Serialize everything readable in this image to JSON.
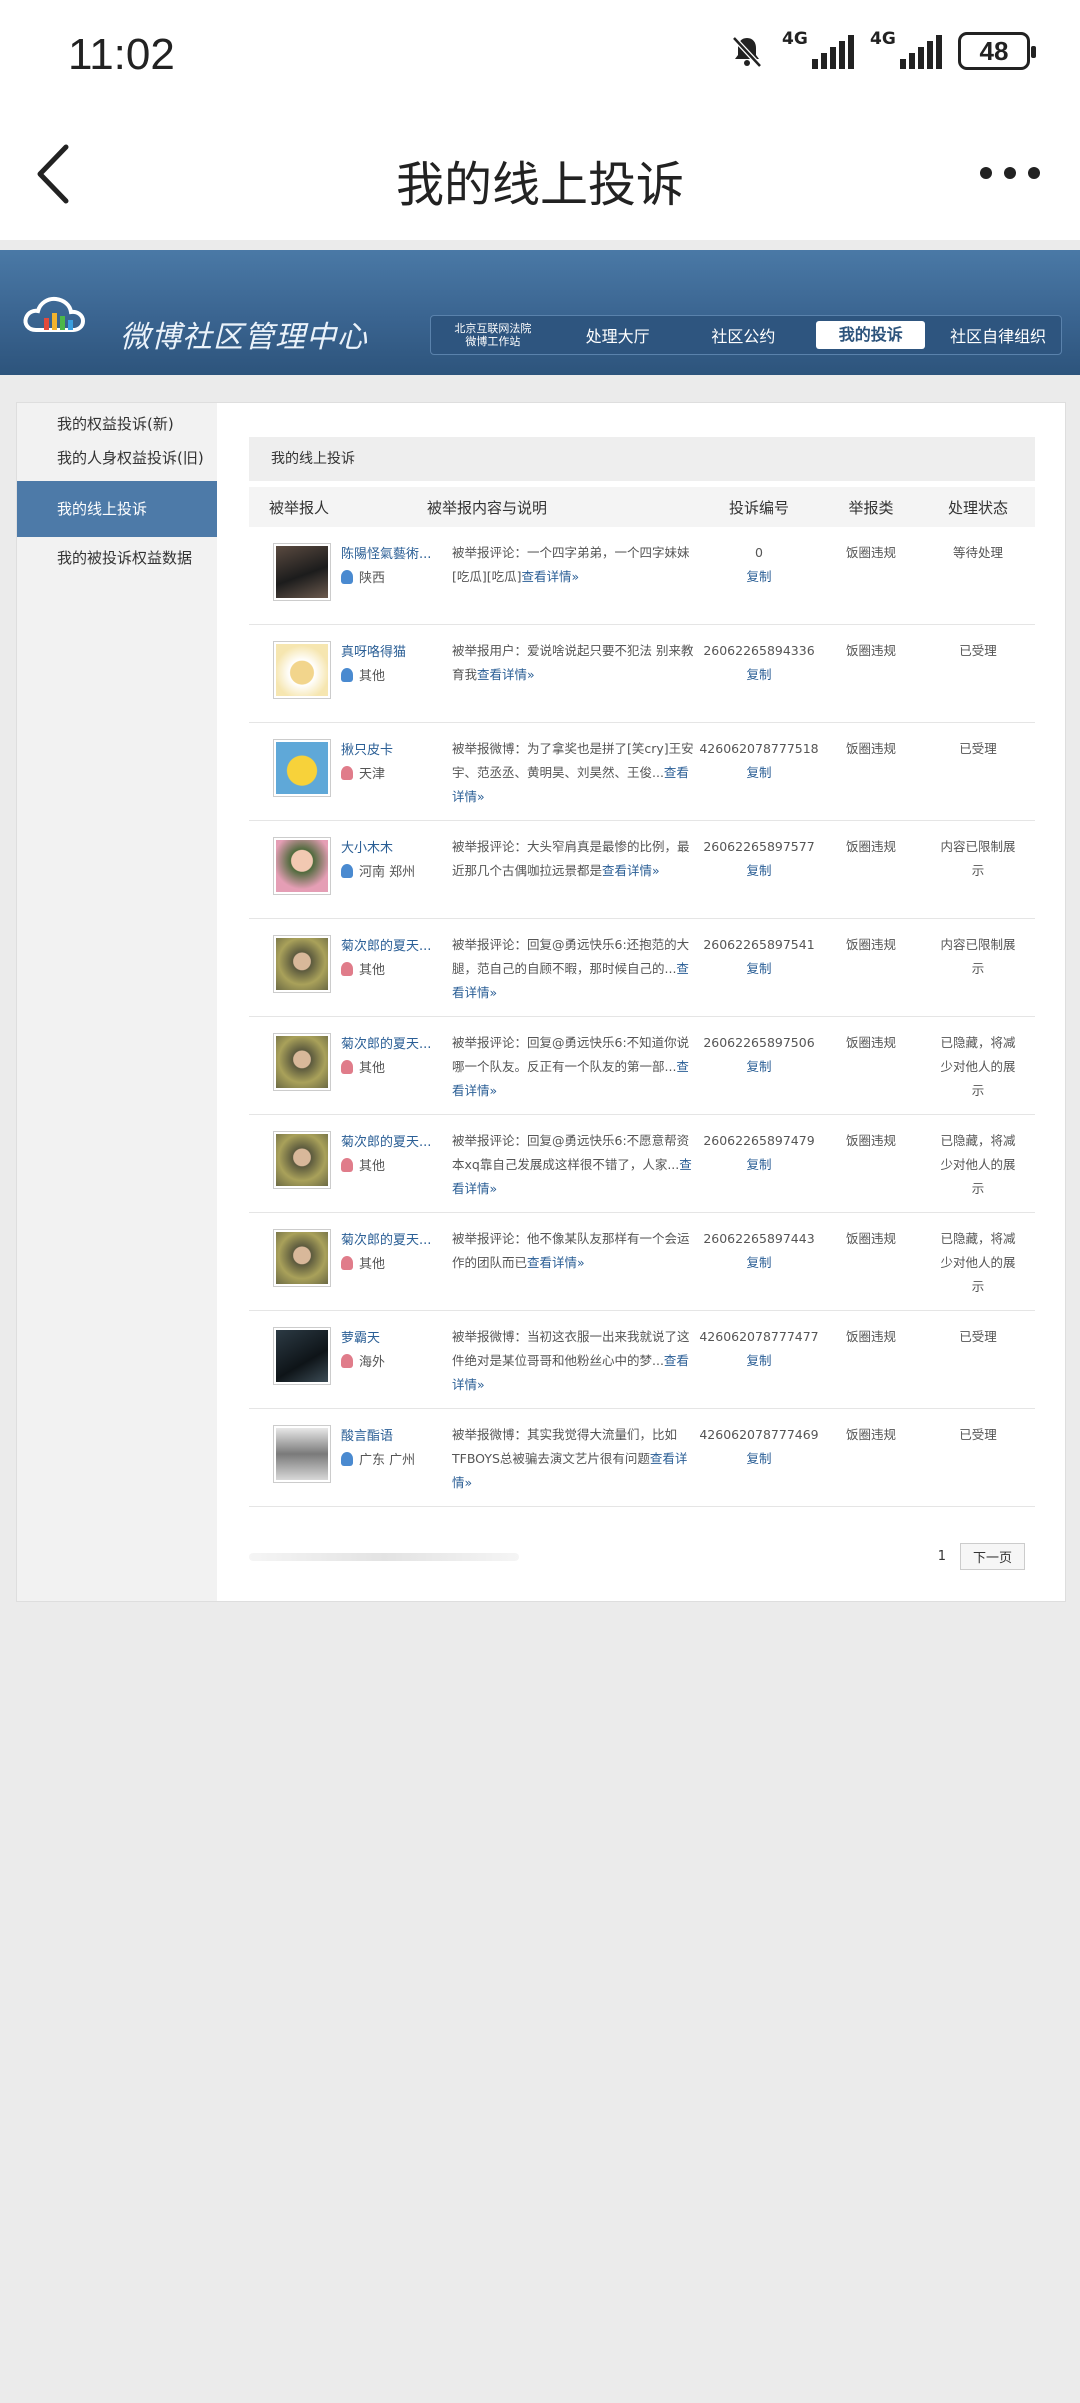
{
  "status": {
    "time": "11:02",
    "net1": "4G",
    "net2": "4G",
    "battery": "48"
  },
  "header": {
    "title": "我的线上投诉"
  },
  "banner": {
    "brand": "微博社区管理中心",
    "nav": {
      "court": "北京互联网法院\n微博工作站",
      "hall": "处理大厅",
      "rules": "社区公约",
      "mine": "我的投诉",
      "org": "社区自律组织"
    }
  },
  "sidebar": {
    "items": [
      "我的权益投诉(新)",
      "我的人身权益投诉(旧)",
      "我的线上投诉",
      "我的被投诉权益数据"
    ]
  },
  "main": {
    "section_title": "我的线上投诉",
    "columns": [
      "被举报人",
      "被举报内容与说明",
      "投诉编号",
      "举报类",
      "处理状态"
    ],
    "rows": [
      {
        "name": "陈陽怪氣藝術...",
        "loc": "陕西",
        "desc": "被举报评论：一个四字弟弟，一个四字妹妹[吃瓜][吃瓜]",
        "more": "查看详情»",
        "num": "0",
        "copy": "复制",
        "type": "饭圈违规",
        "state": "等待处理"
      },
      {
        "name": "真呀咯得猫",
        "loc": "其他",
        "desc": "被举报用户：爱说啥说起只要不犯法 别来教育我",
        "more": "查看详情»",
        "num": "26062265894336",
        "copy": "复制",
        "type": "饭圈违规",
        "state": "已受理"
      },
      {
        "name": "揪只皮卡",
        "loc": "天津",
        "desc": "被举报微博：为了拿奖也是拼了[笑cry]王安宇、范丞丞、黄明昊、刘昊然、王俊...",
        "more": "查看详情»",
        "num": "426062078777518",
        "copy": "复制",
        "type": "饭圈违规",
        "state": "已受理"
      },
      {
        "name": "大小木木",
        "loc": "河南 郑州",
        "desc": "被举报评论：大头窄肩真是最惨的比例，最近那几个古偶咖拉远景都是",
        "more": "查看详情»",
        "num": "26062265897577",
        "copy": "复制",
        "type": "饭圈违规",
        "state": "内容已限制展示"
      },
      {
        "name": "菊次郎的夏天...",
        "loc": "其他",
        "desc": "被举报评论：回复@勇远快乐6:还抱范的大腿，范自己的自顾不暇，那时候自己的...",
        "more": "查看详情»",
        "num": "26062265897541",
        "copy": "复制",
        "type": "饭圈违规",
        "state": "内容已限制展示"
      },
      {
        "name": "菊次郎的夏天...",
        "loc": "其他",
        "desc": "被举报评论：回复@勇远快乐6:不知道你说哪一个队友。反正有一个队友的第一部...",
        "more": "查看详情»",
        "num": "26062265897506",
        "copy": "复制",
        "type": "饭圈违规",
        "state": "已隐藏，将减少对他人的展示"
      },
      {
        "name": "菊次郎的夏天...",
        "loc": "其他",
        "desc": "被举报评论：回复@勇远快乐6:不愿意帮资本xq靠自己发展成这样很不错了，人家...",
        "more": "查看详情»",
        "num": "26062265897479",
        "copy": "复制",
        "type": "饭圈违规",
        "state": "已隐藏，将减少对他人的展示"
      },
      {
        "name": "菊次郎的夏天...",
        "loc": "其他",
        "desc": "被举报评论：他不像某队友那样有一个会运作的团队而已",
        "more": "查看详情»",
        "num": "26062265897443",
        "copy": "复制",
        "type": "饭圈违规",
        "state": "已隐藏，将减少对他人的展示"
      },
      {
        "name": "萝霸天",
        "loc": "海外",
        "desc": "被举报微博：当初这衣服一出来我就说了这件绝对是某位哥哥和他粉丝心中的梦...",
        "more": "查看详情»",
        "num": "426062078777477",
        "copy": "复制",
        "type": "饭圈违规",
        "state": "已受理"
      },
      {
        "name": "酸言酯语",
        "loc": "广东 广州",
        "desc": "被举报微博：其实我觉得大流量们，比如TFBOYS总被骗去演文艺片很有问题",
        "more": "查看详情»",
        "num": "426062078777469",
        "copy": "复制",
        "type": "饭圈违规",
        "state": "已受理"
      }
    ],
    "pager": {
      "page": "1",
      "next": "下一页"
    }
  }
}
